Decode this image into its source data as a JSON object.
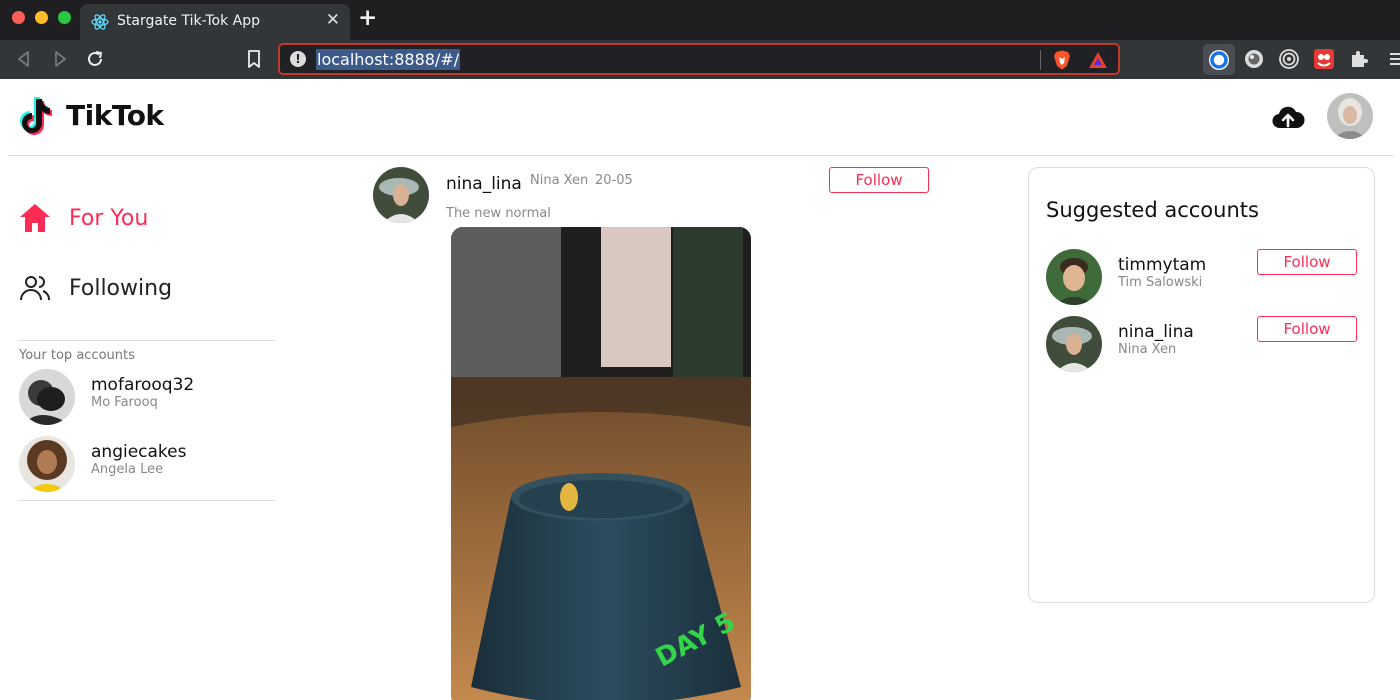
{
  "browser": {
    "tab_title": "Stargate Tik-Tok App",
    "tab_close": "✕",
    "new_tab": "+",
    "url": "localhost:8888/#/",
    "url_info": "!"
  },
  "header": {
    "logo_text": "TikTok"
  },
  "sidebar": {
    "nav": [
      {
        "label": "For You",
        "icon": "home-icon",
        "active": true
      },
      {
        "label": "Following",
        "icon": "people-icon",
        "active": false
      }
    ],
    "top_accounts_heading": "Your top accounts",
    "top_accounts": [
      {
        "username": "mofarooq32",
        "name": "Mo Farooq"
      },
      {
        "username": "angiecakes",
        "name": "Angela Lee"
      }
    ]
  },
  "post": {
    "username": "nina_lina",
    "name": "Nina Xen",
    "date": "20-05",
    "caption": "The new normal",
    "follow_label": "Follow",
    "video_overlay_text": "DAY 5"
  },
  "suggested": {
    "title": "Suggested accounts",
    "accounts": [
      {
        "username": "timmytam",
        "name": "Tim Salowski",
        "follow_label": "Follow"
      },
      {
        "username": "nina_lina",
        "name": "Nina Xen",
        "follow_label": "Follow"
      }
    ]
  },
  "colors": {
    "accent": "#fe2c55",
    "chrome_dark": "#1f1f22",
    "chrome_toolbar": "#323639"
  }
}
